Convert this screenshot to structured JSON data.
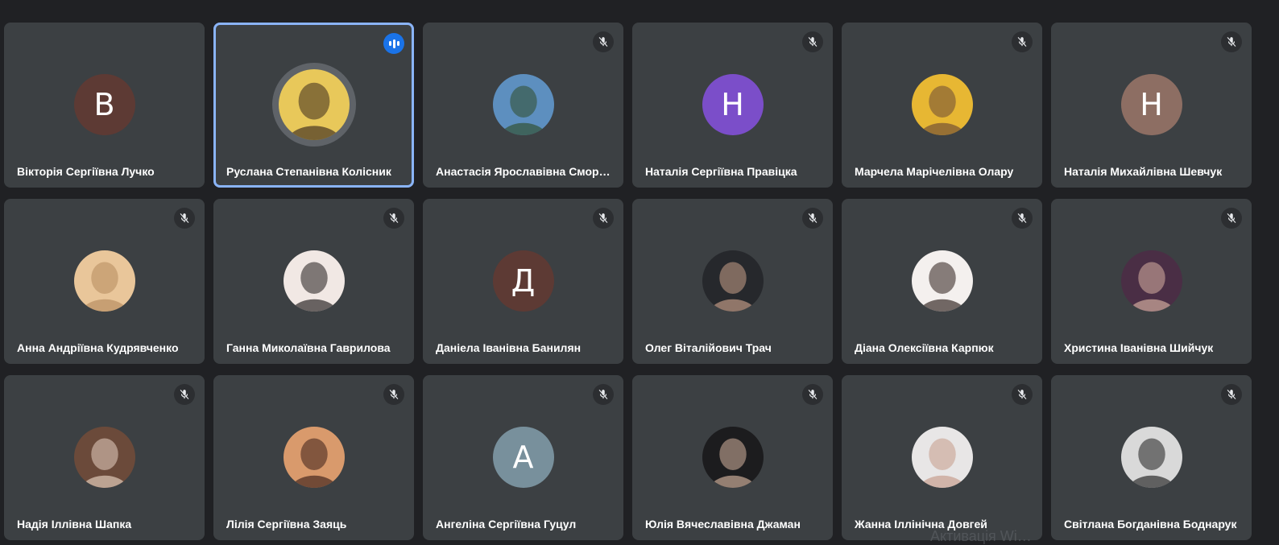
{
  "colors": {
    "background": "#202124",
    "tile": "#3c4043",
    "active_border": "#8ab4f8",
    "speaking_badge": "#1a73e8"
  },
  "participants": [
    {
      "name": "Вікторія Сергіївна Лучко",
      "initial": "В",
      "avatar_color": "#5d3a34",
      "muted": false
    },
    {
      "name": "Руслана Степанівна Колісник",
      "photo": true,
      "photo_tone": [
        "#e8c85a",
        "#3a2a1e"
      ],
      "speaking": true,
      "muted": false
    },
    {
      "name": "Анастасія Ярославівна Смор…",
      "photo": true,
      "photo_tone": [
        "#5d8fbf",
        "#2f4d2a"
      ],
      "muted": true
    },
    {
      "name": "Наталія Сергіївна Правіцка",
      "initial": "Н",
      "avatar_color": "#7b4ec9",
      "muted": true
    },
    {
      "name": "Марчела Марічелівна Олару",
      "photo": true,
      "photo_tone": [
        "#e7b733",
        "#6b4a36"
      ],
      "muted": true
    },
    {
      "name": "Наталія Михайлівна Шевчук",
      "initial": "Н",
      "avatar_color": "#8d6e63",
      "muted": true
    },
    {
      "name": "Анна Андріївна Кудрявченко",
      "photo": true,
      "photo_tone": [
        "#e9c69a",
        "#b58a5d"
      ],
      "muted": true
    },
    {
      "name": "Ганна Миколаївна Гаврилова",
      "photo": true,
      "photo_tone": [
        "#f1e8e4",
        "#1f1a1a"
      ],
      "muted": true
    },
    {
      "name": "Даніела Іванівна Банилян",
      "initial": "Д",
      "avatar_color": "#5d3a34",
      "muted": true
    },
    {
      "name": "Олег Віталійович Трач",
      "photo": true,
      "photo_tone": [
        "#26282c",
        "#c9a08a"
      ],
      "muted": true
    },
    {
      "name": "Діана Олексіївна Карпюк",
      "photo": true,
      "photo_tone": [
        "#f4f0ee",
        "#2b1d1a"
      ],
      "muted": true
    },
    {
      "name": "Христина Іванівна Шийчук",
      "photo": true,
      "photo_tone": [
        "#4a2e45",
        "#d9b3a3"
      ],
      "muted": true
    },
    {
      "name": "Надія Іллівна Шапка",
      "photo": true,
      "photo_tone": [
        "#6b4a3a",
        "#e8d2c2"
      ],
      "muted": true
    },
    {
      "name": "Лілія Сергіївна Заяць",
      "photo": true,
      "photo_tone": [
        "#d99a6c",
        "#3a1f1a"
      ],
      "muted": true
    },
    {
      "name": "Ангеліна Сергіївна Гуцул",
      "initial": "А",
      "avatar_color": "#78909c",
      "muted": true
    },
    {
      "name": "Юлія Вячеславівна Джаман",
      "photo": true,
      "photo_tone": [
        "#1c1c1e",
        "#d6b5a0"
      ],
      "muted": true
    },
    {
      "name": "Жанна Іллінічна Довгей",
      "photo": true,
      "photo_tone": [
        "#e8e6e6",
        "#c59a88"
      ],
      "muted": true
    },
    {
      "name": "Світлана Богданівна Боднарук",
      "photo": true,
      "photo_tone": [
        "#d9d9d9",
        "#1e1e1e"
      ],
      "muted": true
    }
  ],
  "watermark": "Активація Wi…"
}
